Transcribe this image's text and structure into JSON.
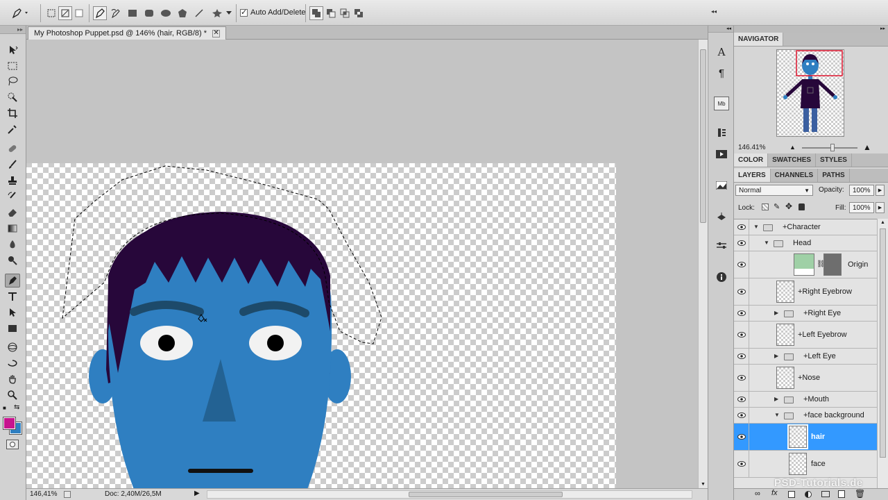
{
  "options_bar": {
    "auto_add_delete_label": "Auto Add/Delete",
    "auto_add_delete_checked": true
  },
  "document": {
    "tab_title": "My Photoshop Puppet.psd @ 146% (hair, RGB/8) *",
    "close_glyph": "✕"
  },
  "status_bar": {
    "zoom": "146,41%",
    "doc_size": "Doc: 2,40M/26,5M"
  },
  "tools": {
    "active_tool": "pen-tool",
    "foreground_color": "#c6148e",
    "background_color": "#2f7fc1"
  },
  "navigator": {
    "tab_label": "NAVIGATOR",
    "zoom": "146.41%"
  },
  "color_panel": {
    "tabs": [
      "COLOR",
      "SWATCHES",
      "STYLES"
    ]
  },
  "layers_panel": {
    "tabs": [
      "LAYERS",
      "CHANNELS",
      "PATHS"
    ],
    "blend_mode": "Normal",
    "opacity_label": "Opacity:",
    "opacity_value": "100%",
    "lock_label": "Lock:",
    "fill_label": "Fill:",
    "fill_value": "100%",
    "layers": [
      {
        "name": "+Character",
        "type": "group",
        "expanded": true
      },
      {
        "name": "Head",
        "type": "group",
        "expanded": true
      },
      {
        "name": "Origin",
        "type": "adjustment"
      },
      {
        "name": "+Right Eyebrow",
        "type": "layer"
      },
      {
        "name": "+Right Eye",
        "type": "group",
        "expanded": false
      },
      {
        "name": "+Left Eyebrow",
        "type": "layer"
      },
      {
        "name": "+Left Eye",
        "type": "group",
        "expanded": false
      },
      {
        "name": "+Nose",
        "type": "layer"
      },
      {
        "name": "+Mouth",
        "type": "group",
        "expanded": false
      },
      {
        "name": "+face background",
        "type": "group",
        "expanded": true
      },
      {
        "name": "hair",
        "type": "layer",
        "selected": true
      },
      {
        "name": "face",
        "type": "layer"
      }
    ]
  },
  "watermark": "PSD-Tutorials.de",
  "colors": {
    "face": "#2f7fc1",
    "hair": "#27073a",
    "eyebrow": "#1d4a6a",
    "nose": "#236293",
    "selection": "#3399ff"
  }
}
